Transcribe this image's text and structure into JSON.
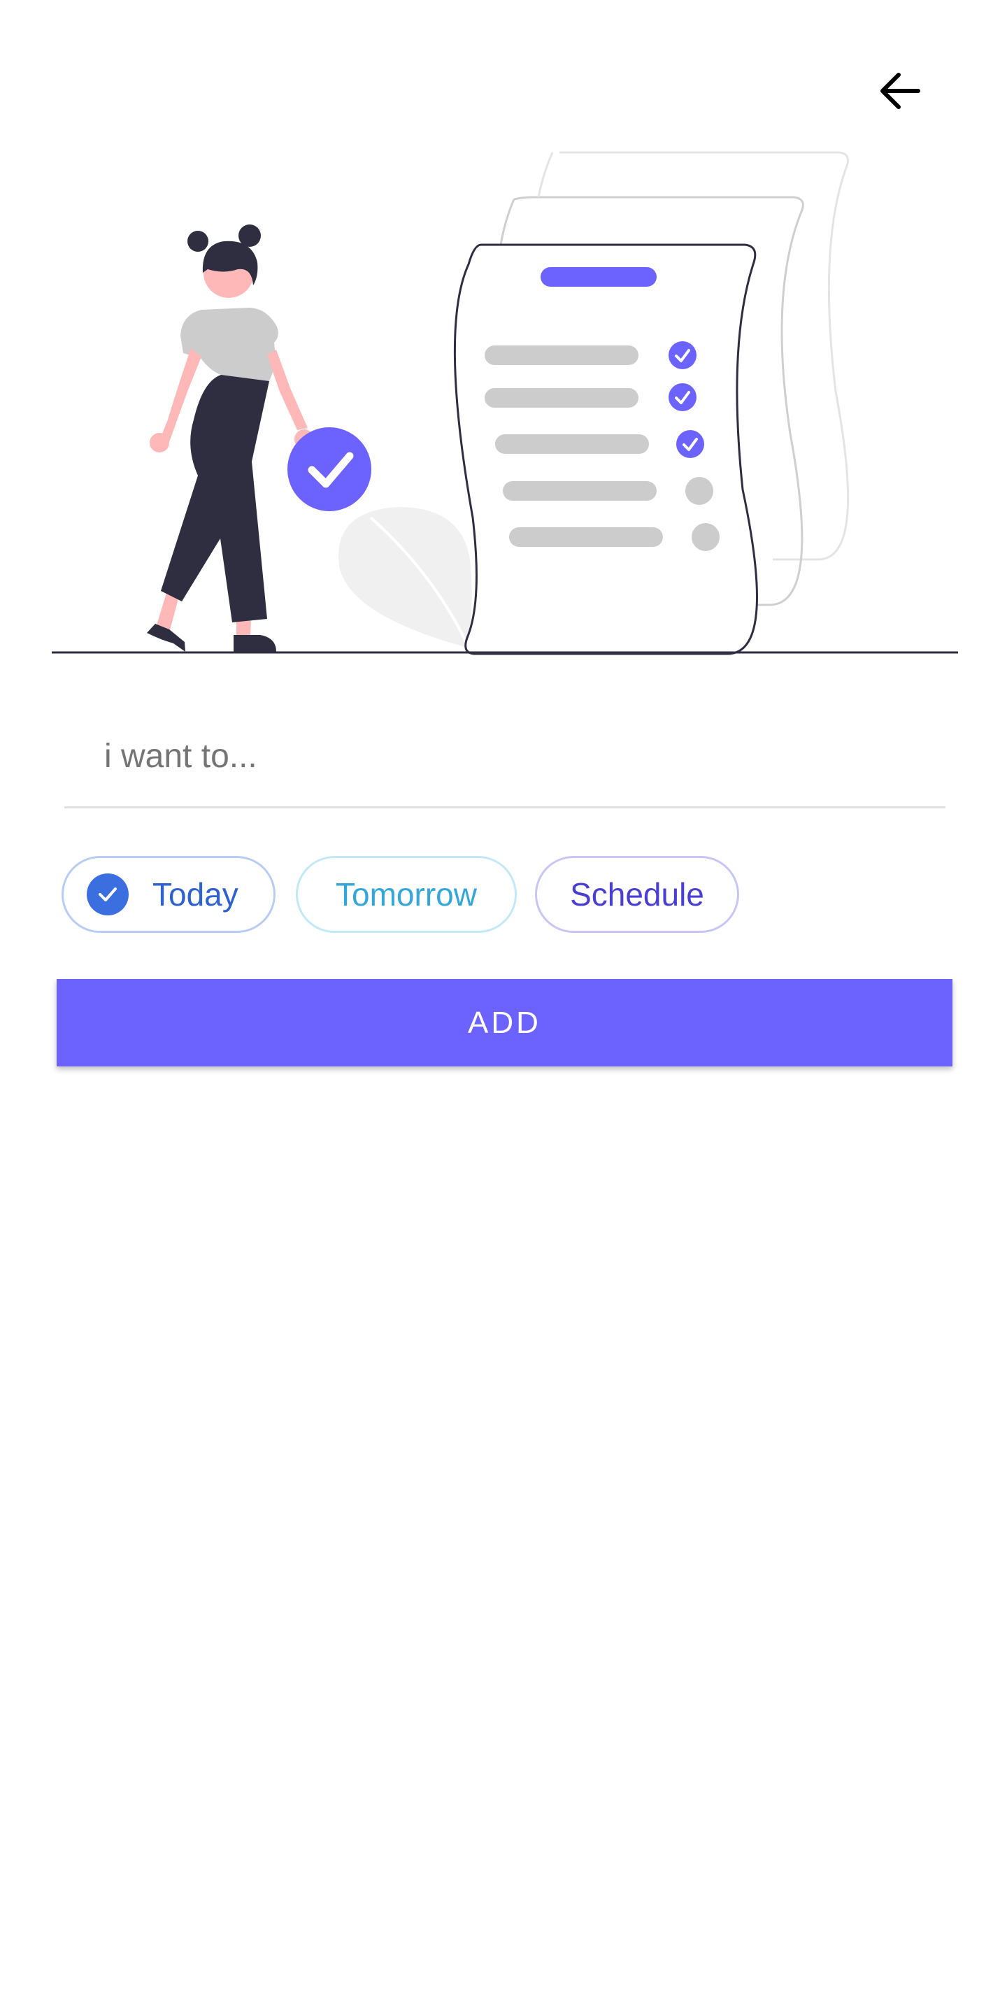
{
  "task_input": {
    "placeholder": "i want to...",
    "value": ""
  },
  "chips": {
    "today": {
      "label": "Today",
      "selected": true
    },
    "tomorrow": {
      "label": "Tomorrow",
      "selected": false
    },
    "schedule": {
      "label": "Schedule",
      "selected": false
    }
  },
  "add_button": {
    "label": "ADD"
  },
  "icons": {
    "back": "arrow-left-icon",
    "chip_check": "check-circle-icon"
  },
  "colors": {
    "accent": "#6c63ff",
    "today": "#2e62cf",
    "tomorrow": "#35a6d8",
    "schedule": "#4a3fd0"
  }
}
